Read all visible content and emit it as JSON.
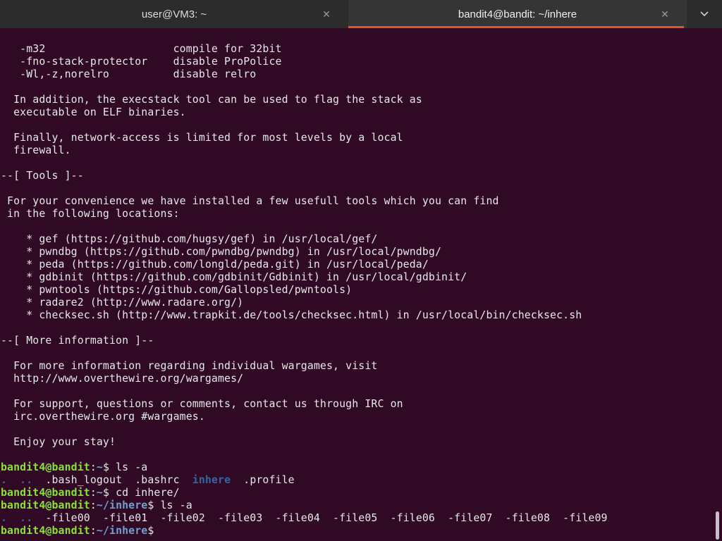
{
  "tabs": [
    {
      "title": "user@VM3: ~",
      "close": "✕"
    },
    {
      "title": "bandit4@bandit: ~/inhere",
      "close": "✕"
    }
  ],
  "tab_menu_icon": "chevron-down-icon",
  "colors": {
    "background": "#300a24",
    "prompt_user": "#8ae234",
    "prompt_path": "#729fcf",
    "directory": "#3465a4",
    "active_tab_underline": "#e95420"
  },
  "motd": [
    "   -m32                    compile for 32bit",
    "   -fno-stack-protector    disable ProPolice",
    "   -Wl,-z,norelro          disable relro",
    "",
    "  In addition, the execstack tool can be used to flag the stack as",
    "  executable on ELF binaries.",
    "",
    "  Finally, network-access is limited for most levels by a local",
    "  firewall.",
    "",
    "--[ Tools ]--",
    "",
    " For your convenience we have installed a few usefull tools which you can find",
    " in the following locations:",
    "",
    "    * gef (https://github.com/hugsy/gef) in /usr/local/gef/",
    "    * pwndbg (https://github.com/pwndbg/pwndbg) in /usr/local/pwndbg/",
    "    * peda (https://github.com/longld/peda.git) in /usr/local/peda/",
    "    * gdbinit (https://github.com/gdbinit/Gdbinit) in /usr/local/gdbinit/",
    "    * pwntools (https://github.com/Gallopsled/pwntools)",
    "    * radare2 (http://www.radare.org/)",
    "    * checksec.sh (http://www.trapkit.de/tools/checksec.html) in /usr/local/bin/checksec.sh",
    "",
    "--[ More information ]--",
    "",
    "  For more information regarding individual wargames, visit",
    "  http://www.overthewire.org/wargames/",
    "",
    "  For support, questions or comments, contact us through IRC on",
    "  irc.overthewire.org #wargames.",
    "",
    "  Enjoy your stay!",
    ""
  ],
  "session": {
    "prompt1": {
      "user": "bandit4@bandit",
      "sep": ":",
      "path": "~",
      "sym": "$ ",
      "cmd": "ls -a"
    },
    "ls1": {
      "dots": ".  ..  ",
      "files": ".bash_logout  .bashrc  ",
      "dir": "inhere",
      "rest": "  .profile"
    },
    "prompt2": {
      "user": "bandit4@bandit",
      "sep": ":",
      "path": "~",
      "sym": "$ ",
      "cmd": "cd inhere/"
    },
    "prompt3": {
      "user": "bandit4@bandit",
      "sep": ":",
      "path": "~/inhere",
      "sym": "$ ",
      "cmd": "ls -a"
    },
    "ls2": {
      "dots": ".  ..  ",
      "files": "-file00  -file01  -file02  -file03  -file04  -file05  -file06  -file07  -file08  -file09"
    },
    "prompt4": {
      "user": "bandit4@bandit",
      "sep": ":",
      "path": "~/inhere",
      "sym": "$"
    }
  }
}
